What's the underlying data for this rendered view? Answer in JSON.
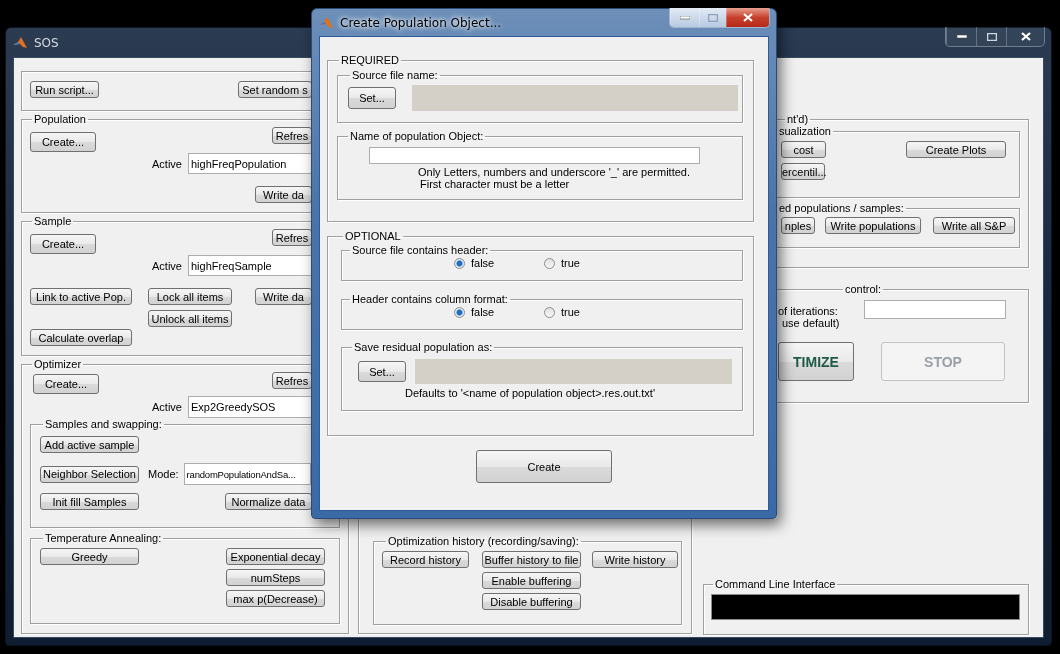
{
  "main_window": {
    "title": "SOS"
  },
  "top_bar": {
    "buttons": [
      "Run script...",
      "Set random s"
    ]
  },
  "population": {
    "legend": "Population",
    "create": "Create...",
    "refresh": "Refres",
    "active_label": "Active",
    "active_value": "highFreqPopulation",
    "write": "Write da"
  },
  "sample": {
    "legend": "Sample",
    "create": "Create...",
    "refresh": "Refres",
    "active_label": "Active",
    "active_value": "highFreqSample",
    "link": "Link to active Pop.",
    "lock": "Lock all items",
    "write": "Write da",
    "unlock": "Unlock all items",
    "overlap": "Calculate overlap"
  },
  "optimizer": {
    "legend": "Optimizer",
    "create": "Create...",
    "refresh": "Refres",
    "active_label": "Active",
    "active_value": "Exp2GreedySOS",
    "swapping": {
      "legend": "Samples and swapping:",
      "add": "Add active sample",
      "neighbor": "Neighbor Selection",
      "mode_label": "Mode:",
      "mode_value": "randomPopulationAndSa...",
      "init": "Init fill Samples",
      "normalize": "Normalize data"
    },
    "annealing": {
      "legend": "Temperature Annealing:",
      "greedy": "Greedy",
      "exponential": "Exponential decay",
      "steps": "numSteps",
      "max_p": "max p(Decrease)"
    }
  },
  "history": {
    "legend": "Optimization history (recording/saving):",
    "record": "Record history",
    "buffer": "Buffer history to file",
    "enable": "Enable buffering",
    "disable": "Disable buffering",
    "write": "Write history"
  },
  "results": {
    "legend": "nt'd)",
    "visualization": {
      "legend": "sualization",
      "cost": "cost",
      "percentile": "ercentil...",
      "plots": "Create Plots"
    },
    "write": {
      "legend": "ed populations / samples:",
      "buttons": [
        "nples",
        "Write populations",
        "Write all S&P"
      ]
    }
  },
  "control": {
    "legend": "control:",
    "iterations_label": "of iterations:",
    "default_label": "use default)",
    "optimize": {
      "label": "TIMIZE",
      "disabled": false
    },
    "stop": {
      "label": "STOP",
      "disabled": true
    }
  },
  "cli": {
    "legend": "Command Line Interface"
  },
  "dialog": {
    "title": "Create Population Object...",
    "required": {
      "legend": "REQUIRED",
      "source": {
        "legend": "Source file name:",
        "button": "Set..."
      },
      "name": {
        "legend": "Name of population Object:",
        "hints": [
          "Only Letters, numbers and underscore '_' are permitted.",
          "First character must be a letter"
        ]
      }
    },
    "optional": {
      "legend": "OPTIONAL",
      "radio_groups": [
        {
          "legend": "Source file contains header:",
          "options": [
            {
              "label": "false",
              "selected": true
            },
            {
              "label": "true",
              "selected": false
            }
          ]
        },
        {
          "legend": "Header contains column format:",
          "options": [
            {
              "label": "false",
              "selected": true
            },
            {
              "label": "true",
              "selected": false
            }
          ]
        }
      ],
      "save": {
        "legend": "Save residual population as:",
        "button": "Set...",
        "note": "Defaults to '<name of population object>.res.out.txt'"
      }
    },
    "create": "Create"
  }
}
